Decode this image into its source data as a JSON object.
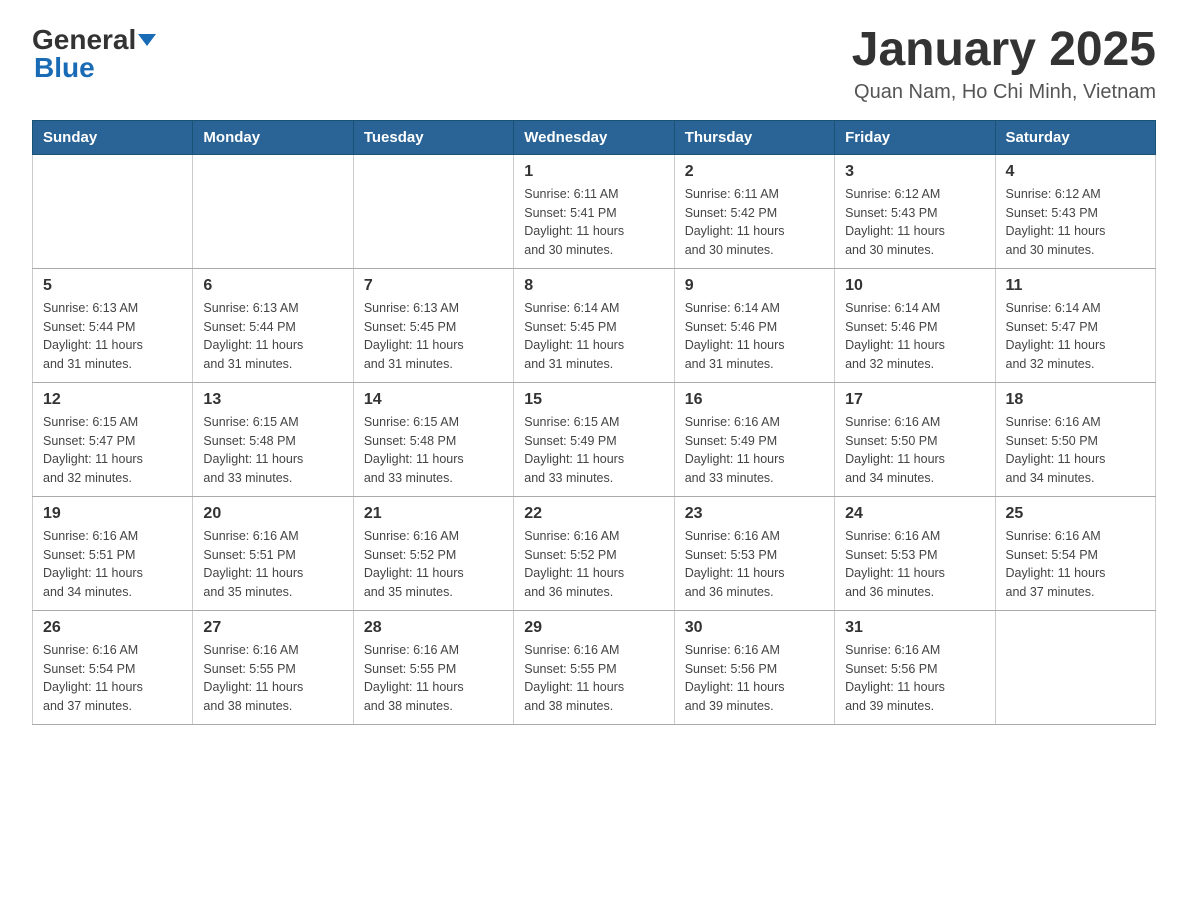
{
  "header": {
    "logo_general": "General",
    "logo_blue": "Blue",
    "title": "January 2025",
    "subtitle": "Quan Nam, Ho Chi Minh, Vietnam"
  },
  "calendar": {
    "days_of_week": [
      "Sunday",
      "Monday",
      "Tuesday",
      "Wednesday",
      "Thursday",
      "Friday",
      "Saturday"
    ],
    "weeks": [
      [
        {
          "day": "",
          "info": ""
        },
        {
          "day": "",
          "info": ""
        },
        {
          "day": "",
          "info": ""
        },
        {
          "day": "1",
          "info": "Sunrise: 6:11 AM\nSunset: 5:41 PM\nDaylight: 11 hours\nand 30 minutes."
        },
        {
          "day": "2",
          "info": "Sunrise: 6:11 AM\nSunset: 5:42 PM\nDaylight: 11 hours\nand 30 minutes."
        },
        {
          "day": "3",
          "info": "Sunrise: 6:12 AM\nSunset: 5:43 PM\nDaylight: 11 hours\nand 30 minutes."
        },
        {
          "day": "4",
          "info": "Sunrise: 6:12 AM\nSunset: 5:43 PM\nDaylight: 11 hours\nand 30 minutes."
        }
      ],
      [
        {
          "day": "5",
          "info": "Sunrise: 6:13 AM\nSunset: 5:44 PM\nDaylight: 11 hours\nand 31 minutes."
        },
        {
          "day": "6",
          "info": "Sunrise: 6:13 AM\nSunset: 5:44 PM\nDaylight: 11 hours\nand 31 minutes."
        },
        {
          "day": "7",
          "info": "Sunrise: 6:13 AM\nSunset: 5:45 PM\nDaylight: 11 hours\nand 31 minutes."
        },
        {
          "day": "8",
          "info": "Sunrise: 6:14 AM\nSunset: 5:45 PM\nDaylight: 11 hours\nand 31 minutes."
        },
        {
          "day": "9",
          "info": "Sunrise: 6:14 AM\nSunset: 5:46 PM\nDaylight: 11 hours\nand 31 minutes."
        },
        {
          "day": "10",
          "info": "Sunrise: 6:14 AM\nSunset: 5:46 PM\nDaylight: 11 hours\nand 32 minutes."
        },
        {
          "day": "11",
          "info": "Sunrise: 6:14 AM\nSunset: 5:47 PM\nDaylight: 11 hours\nand 32 minutes."
        }
      ],
      [
        {
          "day": "12",
          "info": "Sunrise: 6:15 AM\nSunset: 5:47 PM\nDaylight: 11 hours\nand 32 minutes."
        },
        {
          "day": "13",
          "info": "Sunrise: 6:15 AM\nSunset: 5:48 PM\nDaylight: 11 hours\nand 33 minutes."
        },
        {
          "day": "14",
          "info": "Sunrise: 6:15 AM\nSunset: 5:48 PM\nDaylight: 11 hours\nand 33 minutes."
        },
        {
          "day": "15",
          "info": "Sunrise: 6:15 AM\nSunset: 5:49 PM\nDaylight: 11 hours\nand 33 minutes."
        },
        {
          "day": "16",
          "info": "Sunrise: 6:16 AM\nSunset: 5:49 PM\nDaylight: 11 hours\nand 33 minutes."
        },
        {
          "day": "17",
          "info": "Sunrise: 6:16 AM\nSunset: 5:50 PM\nDaylight: 11 hours\nand 34 minutes."
        },
        {
          "day": "18",
          "info": "Sunrise: 6:16 AM\nSunset: 5:50 PM\nDaylight: 11 hours\nand 34 minutes."
        }
      ],
      [
        {
          "day": "19",
          "info": "Sunrise: 6:16 AM\nSunset: 5:51 PM\nDaylight: 11 hours\nand 34 minutes."
        },
        {
          "day": "20",
          "info": "Sunrise: 6:16 AM\nSunset: 5:51 PM\nDaylight: 11 hours\nand 35 minutes."
        },
        {
          "day": "21",
          "info": "Sunrise: 6:16 AM\nSunset: 5:52 PM\nDaylight: 11 hours\nand 35 minutes."
        },
        {
          "day": "22",
          "info": "Sunrise: 6:16 AM\nSunset: 5:52 PM\nDaylight: 11 hours\nand 36 minutes."
        },
        {
          "day": "23",
          "info": "Sunrise: 6:16 AM\nSunset: 5:53 PM\nDaylight: 11 hours\nand 36 minutes."
        },
        {
          "day": "24",
          "info": "Sunrise: 6:16 AM\nSunset: 5:53 PM\nDaylight: 11 hours\nand 36 minutes."
        },
        {
          "day": "25",
          "info": "Sunrise: 6:16 AM\nSunset: 5:54 PM\nDaylight: 11 hours\nand 37 minutes."
        }
      ],
      [
        {
          "day": "26",
          "info": "Sunrise: 6:16 AM\nSunset: 5:54 PM\nDaylight: 11 hours\nand 37 minutes."
        },
        {
          "day": "27",
          "info": "Sunrise: 6:16 AM\nSunset: 5:55 PM\nDaylight: 11 hours\nand 38 minutes."
        },
        {
          "day": "28",
          "info": "Sunrise: 6:16 AM\nSunset: 5:55 PM\nDaylight: 11 hours\nand 38 minutes."
        },
        {
          "day": "29",
          "info": "Sunrise: 6:16 AM\nSunset: 5:55 PM\nDaylight: 11 hours\nand 38 minutes."
        },
        {
          "day": "30",
          "info": "Sunrise: 6:16 AM\nSunset: 5:56 PM\nDaylight: 11 hours\nand 39 minutes."
        },
        {
          "day": "31",
          "info": "Sunrise: 6:16 AM\nSunset: 5:56 PM\nDaylight: 11 hours\nand 39 minutes."
        },
        {
          "day": "",
          "info": ""
        }
      ]
    ]
  }
}
